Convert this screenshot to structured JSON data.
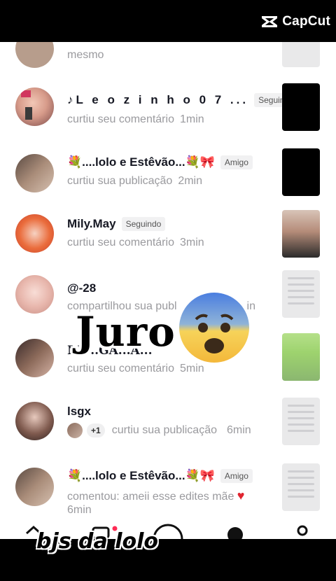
{
  "app": {
    "brand": "CapCut"
  },
  "partial_top": {
    "line": "mesmo"
  },
  "notifications": [
    {
      "name": "♪L e o z i n h o 0 7 ...",
      "badge": "Seguindo",
      "action": "curtiu seu comentário",
      "time": "1min"
    },
    {
      "name": "💐....lolo e Estêvão...💐🎀",
      "badge": "Amigo",
      "action": "curtiu sua publicação",
      "time": "2min"
    },
    {
      "name": "Mily.May",
      "badge": "Seguindo",
      "action": "curtiu seu comentário",
      "time": "3min"
    },
    {
      "name": "@-28",
      "badge": "",
      "action": "compartilhou sua publ",
      "time": "in"
    },
    {
      "name": "𝐁𝐄...𝐆𝐀...𝐀...",
      "badge": "",
      "action": "curtiu seu comentário",
      "time": "5min"
    },
    {
      "name": "lsgx",
      "badge": "",
      "extra": "+1",
      "action": "curtiu sua publicação",
      "time": "6min"
    },
    {
      "name": "💐....lolo e Estêvão...💐🎀",
      "badge": "Amigo",
      "action": "comentou: ameii esse edites mãe",
      "time": "6min"
    }
  ],
  "overlay": {
    "text": "Juro",
    "emoji": "anxious-face"
  },
  "watermark": "bjs da lolo",
  "colors": {
    "accent": "#fe2c55",
    "heart": "#e0242f",
    "badge_bg": "#f1f1f2"
  }
}
